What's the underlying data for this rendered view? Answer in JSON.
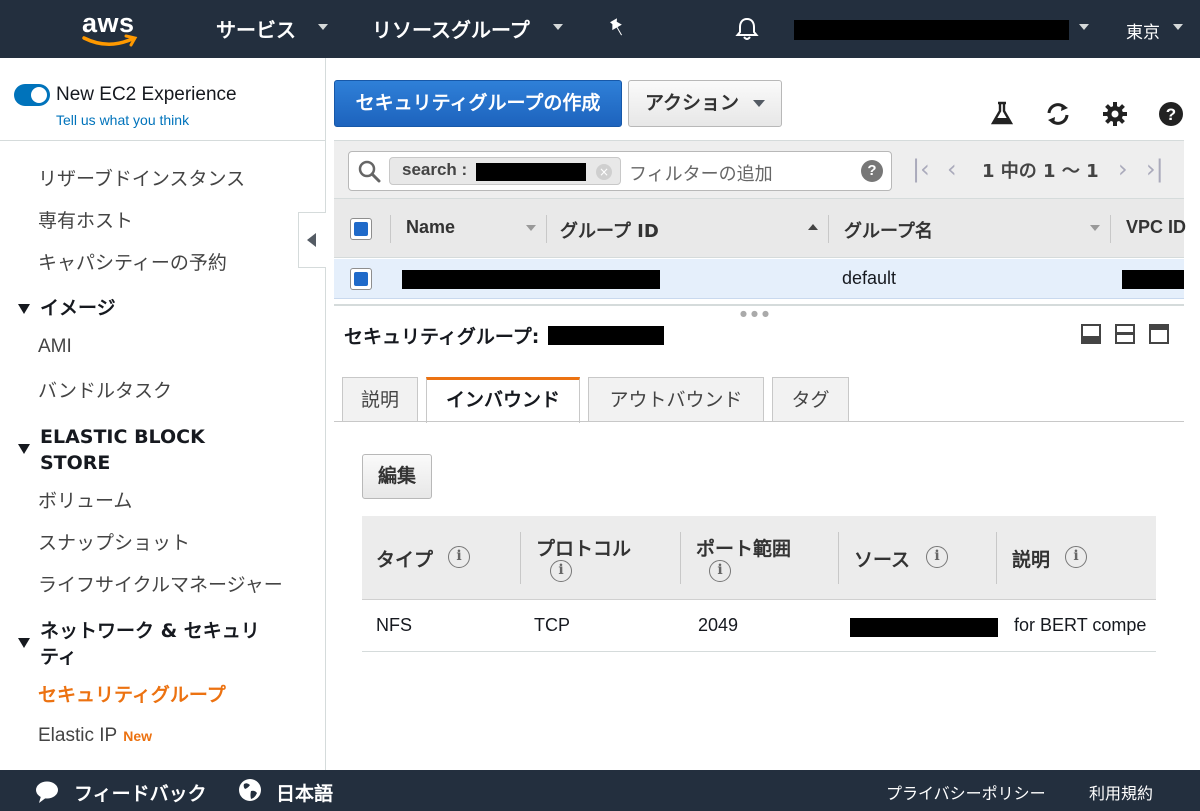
{
  "topnav": {
    "logo_text": "aws",
    "services": "サービス",
    "resource_groups": "リソースグループ",
    "region": "東京"
  },
  "sidebar": {
    "new_experience": "New EC2 Experience",
    "tell_us": "Tell us what you think",
    "links_top": [
      "リザーブドインスタンス",
      "専有ホスト",
      "キャパシティーの予約"
    ],
    "section_images": "イメージ",
    "images_links": [
      "AMI",
      "バンドルタスク"
    ],
    "section_ebs_line1": "ELASTIC BLOCK",
    "section_ebs_line2": "STORE",
    "ebs_links": [
      "ボリューム",
      "スナップショット",
      "ライフサイクルマネージャー"
    ],
    "section_network_line1": "ネットワーク & セキュリ",
    "section_network_line2": "ティ",
    "network_links": [
      "セキュリティグループ",
      "Elastic IP"
    ],
    "new_badge": "New"
  },
  "toolbar": {
    "create_label": "セキュリティグループの作成",
    "actions_label": "アクション"
  },
  "filter": {
    "chip_label": "search :",
    "chip_close": "×",
    "placeholder": "フィルターの追加",
    "help": "?",
    "pagination": "1 中の 1 〜 1"
  },
  "table": {
    "columns": [
      "Name",
      "グループ ID",
      "グループ名",
      "VPC ID"
    ],
    "rows": [
      {
        "group_name": "default"
      }
    ]
  },
  "detail": {
    "title": "セキュリティグループ:",
    "tabs": [
      "説明",
      "インバウンド",
      "アウトバウンド",
      "タグ"
    ],
    "active_tab": "インバウンド",
    "edit_label": "編集",
    "rule_columns": [
      "タイプ",
      "プロトコル",
      "ポート範囲",
      "ソース",
      "説明"
    ],
    "info_glyph": "i",
    "rules": [
      {
        "type": "NFS",
        "protocol": "TCP",
        "port": "2049",
        "description": "for BERT compe"
      }
    ]
  },
  "footer": {
    "feedback": "フィードバック",
    "language": "日本語",
    "privacy": "プライバシーポリシー",
    "terms": "利用規約"
  },
  "colors": {
    "nav_bg": "#232f3e",
    "primary_blue": "#1d63bd",
    "accent_orange": "#ec7211",
    "selected_row": "#e5effb"
  }
}
